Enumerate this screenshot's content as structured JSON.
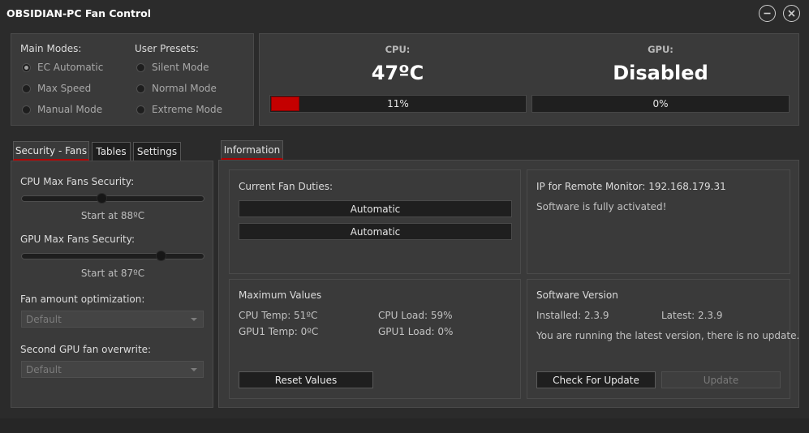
{
  "window": {
    "title": "OBSIDIAN-PC Fan Control"
  },
  "modes": {
    "main_title": "Main Modes:",
    "main": [
      {
        "label": "EC Automatic",
        "selected": true
      },
      {
        "label": "Max Speed",
        "selected": false
      },
      {
        "label": "Manual Mode",
        "selected": false
      }
    ],
    "presets_title": "User Presets:",
    "presets": [
      {
        "label": "Silent Mode",
        "selected": false
      },
      {
        "label": "Normal Mode",
        "selected": false
      },
      {
        "label": "Extreme Mode",
        "selected": false
      }
    ]
  },
  "monitor": {
    "cpu": {
      "label": "CPU:",
      "value": "47ºC",
      "load_text": "11%",
      "load": 0.11
    },
    "gpu": {
      "label": "GPU:",
      "value": "Disabled",
      "load_text": "0%",
      "load": 0.0
    },
    "bar_color": "#c40000"
  },
  "left_tabs": {
    "items": [
      "Security - Fans",
      "Tables",
      "Settings"
    ],
    "active": 0
  },
  "security": {
    "cpu_label": "CPU Max Fans Security:",
    "cpu_value": "Start at 88ºC",
    "cpu_fraction": 0.44,
    "gpu_label": "GPU Max Fans Security:",
    "gpu_value": "Start at 87ºC",
    "gpu_fraction": 0.76,
    "fan_opt_label": "Fan amount optimization:",
    "fan_opt_value": "Default",
    "second_gpu_label": "Second GPU fan overwrite:",
    "second_gpu_value": "Default"
  },
  "right_tabs": {
    "items": [
      "Information"
    ],
    "active": 0
  },
  "info": {
    "duties_title": "Current Fan Duties:",
    "duties": [
      "Automatic",
      "Automatic"
    ],
    "ip_text": "IP for Remote Monitor: 192.168.179.31",
    "activation_text": "Software is fully activated!",
    "max_title": "Maximum Values",
    "cpu_temp": "CPU Temp: 51ºC",
    "cpu_load": "CPU Load: 59%",
    "gpu_temp": "GPU1 Temp: 0ºC",
    "gpu_load": "GPU1 Load: 0%",
    "reset_label": "Reset Values",
    "version_title": "Software Version",
    "installed": "Installed: 2.3.9",
    "latest": "Latest: 2.3.9",
    "version_msg": "You are running the latest version, there is no update.",
    "check_label": "Check For Update",
    "update_label": "Update"
  },
  "icons": {
    "minimize": "minimize-icon",
    "close": "close-icon"
  }
}
